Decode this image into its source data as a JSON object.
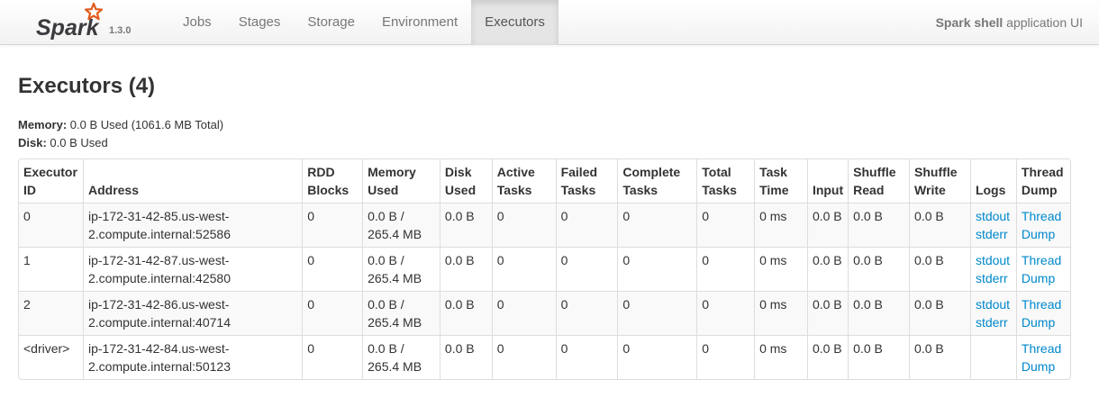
{
  "header": {
    "logo_text": "Spark",
    "version": "1.3.0",
    "tabs": [
      {
        "label": "Jobs",
        "active": false
      },
      {
        "label": "Stages",
        "active": false
      },
      {
        "label": "Storage",
        "active": false
      },
      {
        "label": "Environment",
        "active": false
      },
      {
        "label": "Executors",
        "active": true
      }
    ],
    "app_name": "Spark shell",
    "app_suffix": " application UI"
  },
  "page": {
    "title": "Executors (4)",
    "memory_label": "Memory:",
    "memory_value": " 0.0 B Used (1061.6 MB Total)",
    "disk_label": "Disk:",
    "disk_value": " 0.0 B Used"
  },
  "table": {
    "columns": [
      [
        "Executor",
        "ID"
      ],
      [
        "Address"
      ],
      [
        "RDD",
        "Blocks"
      ],
      [
        "Memory",
        "Used"
      ],
      [
        "Disk",
        "Used"
      ],
      [
        "Active",
        "Tasks"
      ],
      [
        "Failed",
        "Tasks"
      ],
      [
        "Complete",
        "Tasks"
      ],
      [
        "Total",
        "Tasks"
      ],
      [
        "Task",
        "Time"
      ],
      [
        "Input"
      ],
      [
        "Shuffle",
        "Read"
      ],
      [
        "Shuffle",
        "Write"
      ],
      [
        "Logs"
      ],
      [
        "Thread",
        "Dump"
      ]
    ],
    "rows": [
      {
        "id": "0",
        "address": [
          "ip-172-31-42-85.us-west-",
          "2.compute.internal:52586"
        ],
        "rdd_blocks": "0",
        "memory_used": [
          "0.0 B /",
          "265.4 MB"
        ],
        "disk_used": "0.0 B",
        "active_tasks": "0",
        "failed_tasks": "0",
        "complete_tasks": "0",
        "total_tasks": "0",
        "task_time": "0 ms",
        "input": "0.0 B",
        "shuffle_read": "0.0 B",
        "shuffle_write": "0.0 B",
        "logs": [
          "stdout",
          "stderr"
        ],
        "thread_dump": [
          "Thread",
          "Dump"
        ]
      },
      {
        "id": "1",
        "address": [
          "ip-172-31-42-87.us-west-",
          "2.compute.internal:42580"
        ],
        "rdd_blocks": "0",
        "memory_used": [
          "0.0 B /",
          "265.4 MB"
        ],
        "disk_used": "0.0 B",
        "active_tasks": "0",
        "failed_tasks": "0",
        "complete_tasks": "0",
        "total_tasks": "0",
        "task_time": "0 ms",
        "input": "0.0 B",
        "shuffle_read": "0.0 B",
        "shuffle_write": "0.0 B",
        "logs": [
          "stdout",
          "stderr"
        ],
        "thread_dump": [
          "Thread",
          "Dump"
        ]
      },
      {
        "id": "2",
        "address": [
          "ip-172-31-42-86.us-west-",
          "2.compute.internal:40714"
        ],
        "rdd_blocks": "0",
        "memory_used": [
          "0.0 B /",
          "265.4 MB"
        ],
        "disk_used": "0.0 B",
        "active_tasks": "0",
        "failed_tasks": "0",
        "complete_tasks": "0",
        "total_tasks": "0",
        "task_time": "0 ms",
        "input": "0.0 B",
        "shuffle_read": "0.0 B",
        "shuffle_write": "0.0 B",
        "logs": [
          "stdout",
          "stderr"
        ],
        "thread_dump": [
          "Thread",
          "Dump"
        ]
      },
      {
        "id": "<driver>",
        "address": [
          "ip-172-31-42-84.us-west-",
          "2.compute.internal:50123"
        ],
        "rdd_blocks": "0",
        "memory_used": [
          "0.0 B /",
          "265.4 MB"
        ],
        "disk_used": "0.0 B",
        "active_tasks": "0",
        "failed_tasks": "0",
        "complete_tasks": "0",
        "total_tasks": "0",
        "task_time": "0 ms",
        "input": "0.0 B",
        "shuffle_read": "0.0 B",
        "shuffle_write": "0.0 B",
        "logs": [],
        "thread_dump": [
          "Thread",
          "Dump"
        ]
      }
    ]
  },
  "colors": {
    "link": "#0088cc",
    "logo_star": "#e25a1c",
    "logo_text": "#3c3a3e",
    "active_tab_bg": "#e5e5e5"
  }
}
